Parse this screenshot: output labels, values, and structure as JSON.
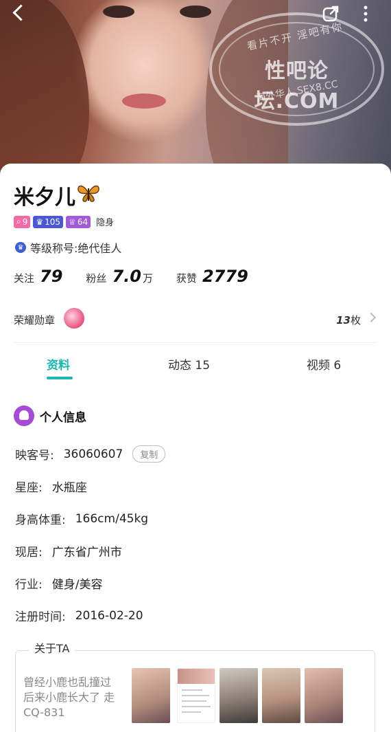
{
  "header": {
    "back_icon": "back-chevron-icon",
    "share_icon": "share-icon",
    "more_icon": "more-vertical-icon",
    "watermark": {
      "line1": "看片不开 淫吧有你",
      "line2": "性吧论坛.COM",
      "line3": "海外华人 SEX8.CC"
    }
  },
  "profile": {
    "name": "米夕儿",
    "name_emoji": "butterfly-icon",
    "badges": [
      {
        "icon": "search-level-icon",
        "value": "9"
      },
      {
        "icon": "crown-icon",
        "value": "105"
      },
      {
        "icon": "crown-purple-icon",
        "value": "64"
      }
    ],
    "hidden_label": "隐身",
    "title_label": "等级称号:绝代佳人",
    "stats": {
      "follow_label": "关注",
      "follow_value": "79",
      "fans_label": "粉丝",
      "fans_value": "7.0",
      "fans_unit": "万",
      "likes_label": "获赞",
      "likes_value": "2779"
    },
    "medals": {
      "label": "荣耀勋章",
      "count": "13",
      "count_unit": "枚"
    }
  },
  "tabs": [
    {
      "label": "资料",
      "active": true
    },
    {
      "label": "动态 15",
      "active": false
    },
    {
      "label": "视频 6",
      "active": false
    }
  ],
  "info": {
    "section_title": "个人信息",
    "rows": [
      {
        "label": "映客号:",
        "value": "36060607"
      },
      {
        "label": "星座:",
        "value": "水瓶座"
      },
      {
        "label": "身高体重:",
        "value": "166cm/45kg"
      },
      {
        "label": "现居:",
        "value": "广东省广州市"
      },
      {
        "label": "行业:",
        "value": "健身/美容"
      },
      {
        "label": "注册时间:",
        "value": "2016-02-20"
      }
    ],
    "copy_label": "复制"
  },
  "about": {
    "title": "关于TA",
    "lines": [
      "曾经小鹿也乱撞过",
      "后来小鹿长大了 走",
      "CQ-831"
    ]
  },
  "colors": {
    "accent": "#18b6b4",
    "badge_pink": "#f26aa6",
    "badge_blue": "#4b57d6",
    "badge_purple": "#a35ad8"
  }
}
